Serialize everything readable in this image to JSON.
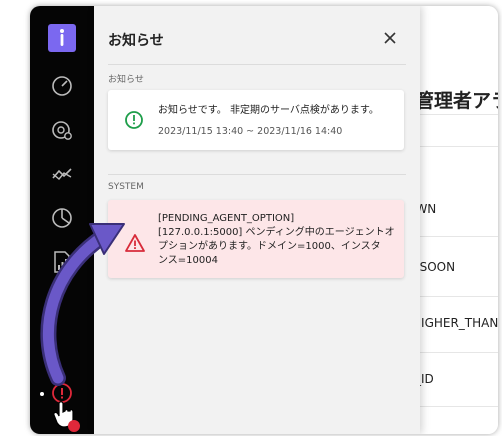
{
  "panel": {
    "title": "お知らせ",
    "close_icon": "close-icon"
  },
  "sections": {
    "notice_label": "お知らせ",
    "system_label": "SYSTEM"
  },
  "notice": {
    "message": "お知らせです。 非定期のサーバ点検があります。",
    "period": "2023/11/15 13:40 ~ 2023/11/16 14:40",
    "icon": "info-circle-icon",
    "icon_color": "#1e9e4a"
  },
  "system_alert": {
    "line1": "[PENDING_AGENT_OPTION]",
    "line2": "[127.0.0.1:5000] ペンディング中のエージェントオ",
    "line3": "プションがあります。ドメイン=1000、インスタ",
    "line4": "ンス=10004",
    "icon": "warning-triangle-icon",
    "icon_color": "#d82b3a",
    "background": "#fde6e8"
  },
  "background_page": {
    "title": "管理者アラ",
    "rows": [
      "OWN",
      "E_SOON",
      "_HIGHER_THAN",
      "N_ID"
    ]
  },
  "sidebar": {
    "icons": [
      "logo-icon",
      "gauge-icon",
      "settings-gear-icon",
      "trend-icon",
      "pie-chart-icon",
      "report-icon",
      "alert-icon"
    ],
    "accent": "#7b68f0",
    "alert_color": "#e0283a"
  }
}
